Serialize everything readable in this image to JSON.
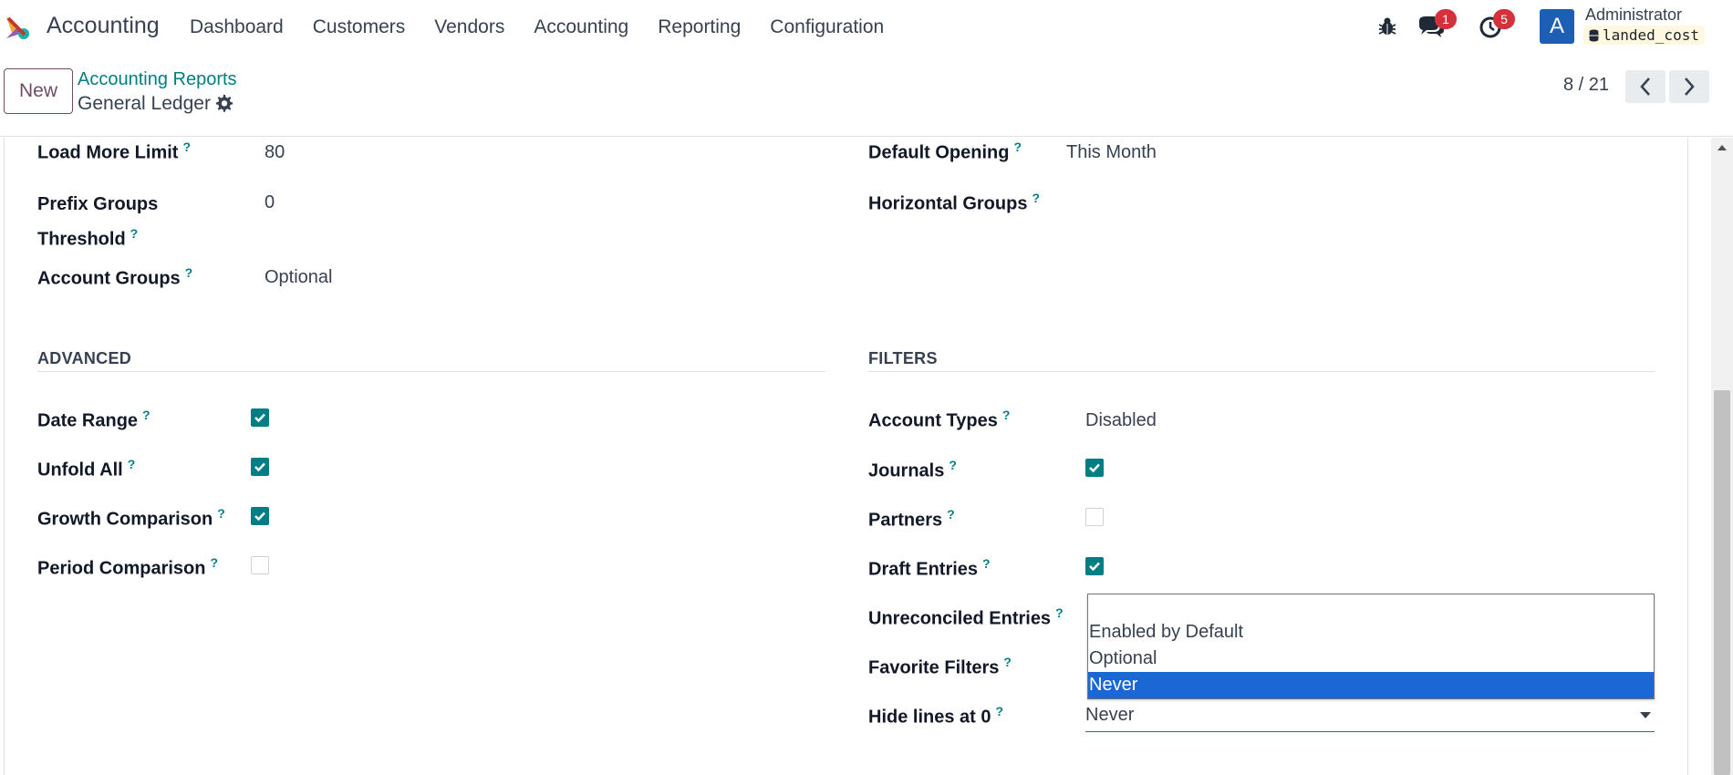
{
  "navbar": {
    "app_name": "Accounting",
    "menu": [
      "Dashboard",
      "Customers",
      "Vendors",
      "Accounting",
      "Reporting",
      "Configuration"
    ],
    "chat_badge": "1",
    "activity_badge": "5",
    "user": {
      "initial": "A",
      "name": "Administrator",
      "database": "landed_cost"
    }
  },
  "control": {
    "new_label": "New",
    "breadcrumb_parent": "Accounting Reports",
    "breadcrumb_current": "General Ledger",
    "pager": "8 / 21"
  },
  "fields_top": {
    "load_more_limit": {
      "label": "Load More Limit",
      "value": "80"
    },
    "prefix_groups_threshold": {
      "label_line1": "Prefix Groups",
      "label_line2": "Threshold",
      "value": "0"
    },
    "account_groups": {
      "label": "Account Groups",
      "value": "Optional"
    },
    "default_opening": {
      "label": "Default Opening",
      "value": "This Month"
    },
    "horizontal_groups": {
      "label": "Horizontal Groups",
      "value": ""
    }
  },
  "advanced": {
    "title": "ADVANCED",
    "fields": [
      {
        "label": "Date Range",
        "checked": true
      },
      {
        "label": "Unfold All",
        "checked": true
      },
      {
        "label": "Growth Comparison",
        "checked": true
      },
      {
        "label": "Period Comparison",
        "checked": false
      }
    ]
  },
  "filters": {
    "title": "FILTERS",
    "account_types": {
      "label": "Account Types",
      "value": "Disabled"
    },
    "journals": {
      "label": "Journals",
      "checked": true
    },
    "partners": {
      "label": "Partners",
      "checked": false
    },
    "draft_entries": {
      "label": "Draft Entries",
      "checked": true
    },
    "unreconciled_entries": {
      "label": "Unreconciled Entries"
    },
    "favorite_filters": {
      "label": "Favorite Filters"
    },
    "hide_lines": {
      "label": "Hide lines at 0",
      "value": "Never"
    }
  },
  "dropdown": {
    "options": [
      "",
      "Enabled by Default",
      "Optional",
      "Never"
    ],
    "selected": "Never"
  },
  "colors": {
    "accent": "#017e84",
    "brand": "#714b67",
    "selection": "#1a68d6",
    "badge": "#d6303a"
  },
  "help_mark": "?"
}
